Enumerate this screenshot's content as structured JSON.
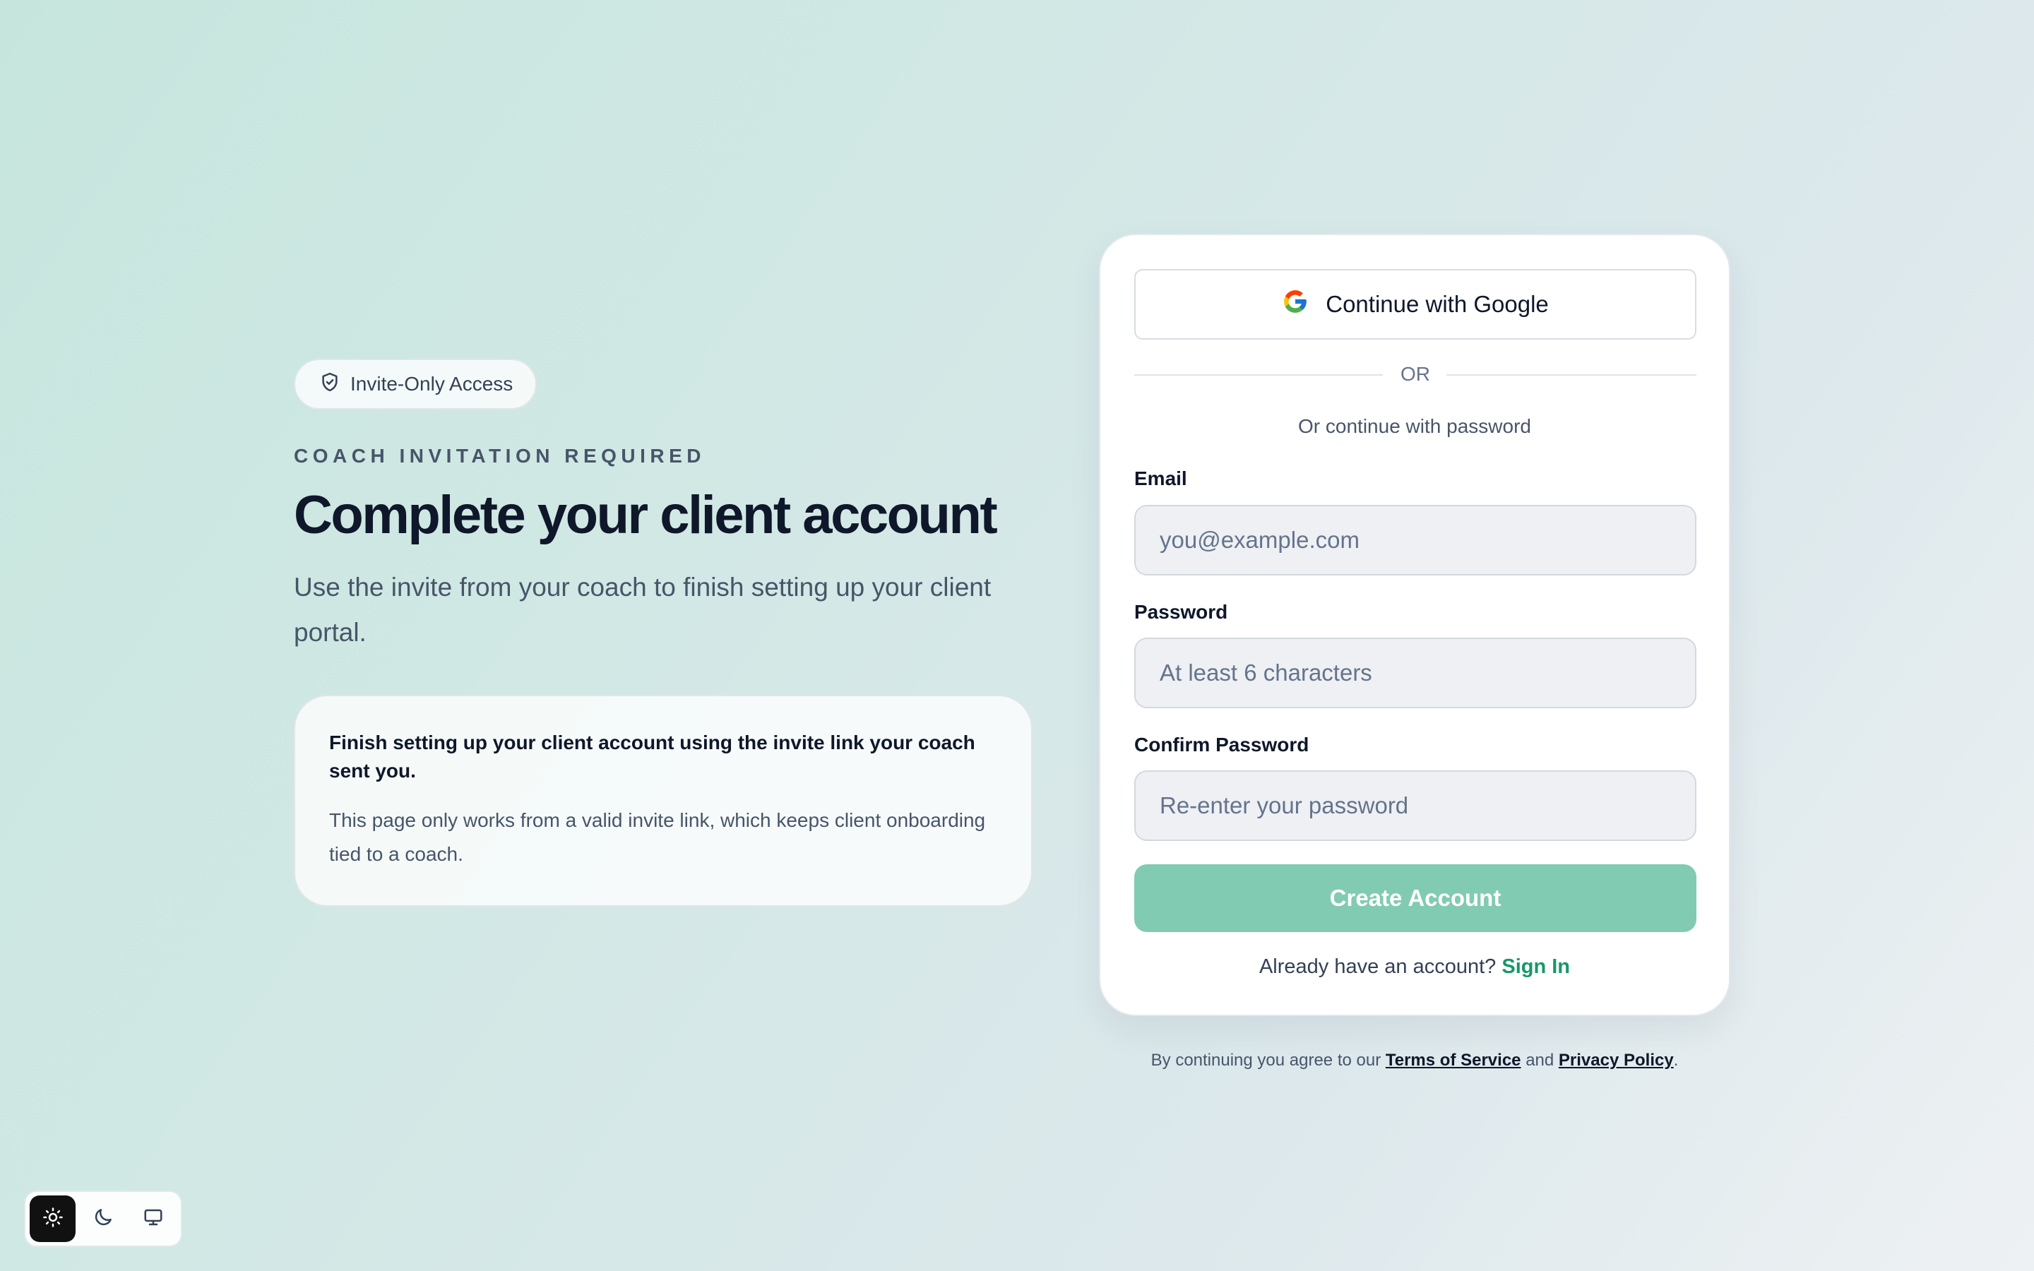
{
  "left": {
    "badge": {
      "label": "Invite-Only Access",
      "icon": "shield-check-icon"
    },
    "eyebrow": "COACH INVITATION REQUIRED",
    "headline": "Complete your client account",
    "subtitle": "Use the invite from your coach to finish setting up your client portal.",
    "info_card": {
      "title": "Finish setting up your client account using the invite link your coach sent you.",
      "body": "This page only works from a valid invite link, which keeps client onboarding tied to a coach."
    }
  },
  "form": {
    "google_button": "Continue with Google",
    "divider": "OR",
    "continue_with_password": "Or continue with password",
    "email": {
      "label": "Email",
      "value": "",
      "placeholder": "you@example.com"
    },
    "password": {
      "label": "Password",
      "value": "",
      "placeholder": "At least 6 characters"
    },
    "confirm_password": {
      "label": "Confirm Password",
      "value": "",
      "placeholder": "Re-enter your password"
    },
    "submit": "Create Account",
    "signin_prompt": "Already have an account?",
    "signin_link": "Sign In"
  },
  "terms": {
    "prefix": "By continuing you agree to our",
    "terms_link": "Terms of Service",
    "conjunction": "and",
    "privacy_link": "Privacy Policy",
    "suffix": "."
  },
  "theme_toggle": {
    "options": [
      "sun-icon",
      "moon-icon",
      "monitor-icon"
    ],
    "active": "sun-icon"
  },
  "colors": {
    "accent": "#16986a",
    "button_disabled": "#82cbb3",
    "heading": "#0f172a",
    "muted": "#475569"
  }
}
